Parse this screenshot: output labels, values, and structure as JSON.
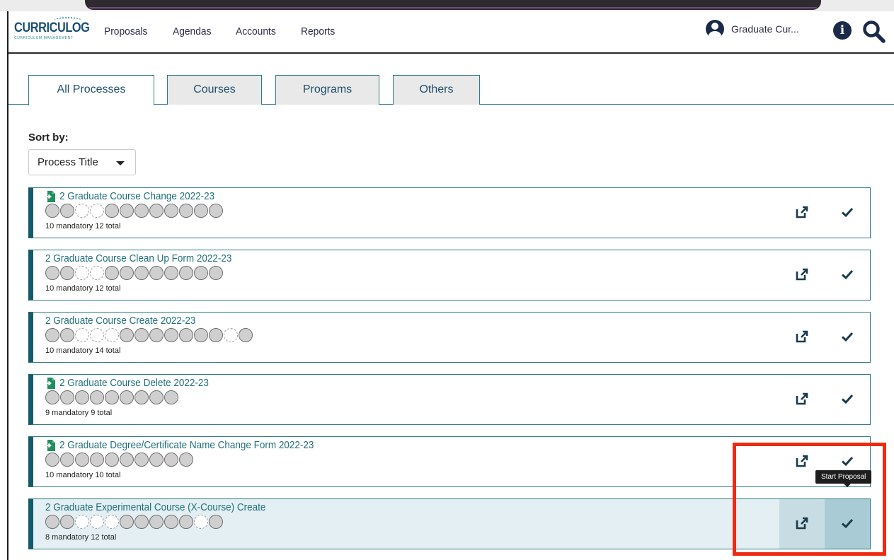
{
  "app": {
    "logo_text": "CURRICULOG",
    "logo_subtitle": "CURRICULUM MANAGEMENT"
  },
  "nav": {
    "items": [
      "Proposals",
      "Agendas",
      "Accounts",
      "Reports"
    ]
  },
  "user": {
    "name": "Graduate Cur..."
  },
  "tabs": [
    "All Processes",
    "Courses",
    "Programs",
    "Others"
  ],
  "sort": {
    "label": "Sort by:",
    "value": "Process Title"
  },
  "processes": [
    {
      "title": "2 Graduate Course Change 2022-23",
      "counts": "10 mandatory 12 total",
      "file_icon": true,
      "steps": [
        "m",
        "m",
        "o",
        "o",
        "m",
        "m",
        "m",
        "m",
        "m",
        "m",
        "m",
        "m"
      ]
    },
    {
      "title": "2 Graduate Course Clean Up Form 2022-23",
      "counts": "10 mandatory 12 total",
      "file_icon": false,
      "steps": [
        "m",
        "m",
        "o",
        "o",
        "m",
        "m",
        "m",
        "m",
        "m",
        "m",
        "m",
        "m"
      ]
    },
    {
      "title": "2 Graduate Course Create 2022-23",
      "counts": "10 mandatory 14 total",
      "file_icon": false,
      "steps": [
        "m",
        "m",
        "o",
        "o",
        "o",
        "m",
        "m",
        "m",
        "m",
        "m",
        "m",
        "m",
        "o",
        "m"
      ]
    },
    {
      "title": "2 Graduate Course Delete 2022-23",
      "counts": "9 mandatory 9 total",
      "file_icon": true,
      "steps": [
        "m",
        "m",
        "m",
        "m",
        "m",
        "m",
        "m",
        "m",
        "m"
      ]
    },
    {
      "title": "2 Graduate Degree/Certificate Name Change Form 2022-23",
      "counts": "10 mandatory 10 total",
      "file_icon": true,
      "steps": [
        "m",
        "m",
        "m",
        "m",
        "m",
        "m",
        "m",
        "m",
        "m",
        "m"
      ]
    },
    {
      "title": "2 Graduate Experimental Course (X-Course) Create",
      "counts": "8 mandatory 12 total",
      "file_icon": false,
      "highlighted": true,
      "steps": [
        "m",
        "m",
        "o",
        "o",
        "o",
        "m",
        "m",
        "m",
        "m",
        "m",
        "o",
        "m"
      ]
    }
  ],
  "tooltip": {
    "text": "Start Proposal"
  },
  "colors": {
    "accent": "#2e7a83",
    "row_border": "#155a6a",
    "highlight_annotation": "#ef2a12"
  }
}
